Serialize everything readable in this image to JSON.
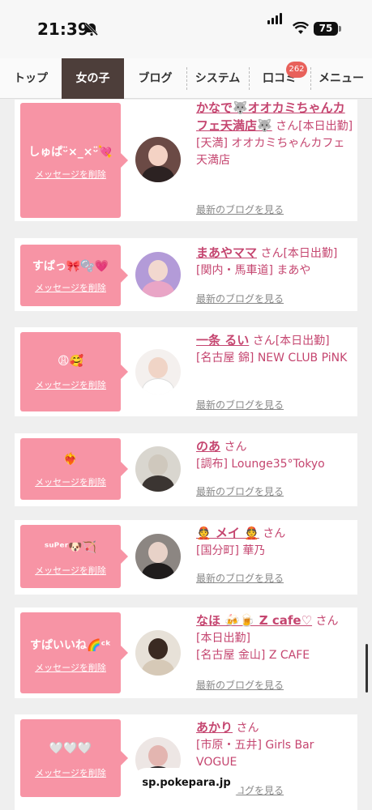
{
  "status": {
    "time": "21:39",
    "battery": "75"
  },
  "tabs": [
    {
      "label": "トップ"
    },
    {
      "label": "女の子"
    },
    {
      "label": "ブログ"
    },
    {
      "label": "システム"
    },
    {
      "label": "口コミ",
      "badge": "262"
    },
    {
      "label": "メニュー"
    }
  ],
  "common": {
    "delete_label": "メッセージを削除",
    "blog_label": "最新のブログを見る",
    "san": "さん"
  },
  "cards": [
    {
      "message": "しゅぱᵕ̈×_×ᵕ̈💘",
      "name": "かなで🐺オオカミちゃんカフェ天満店🐺",
      "status": "[本日出勤]",
      "location": "[天満] オオカミちゃんカフェ天満店"
    },
    {
      "message": "すぱっ🎀🫧💗",
      "name": "まあやママ",
      "status": "[本日出勤]",
      "location": "[関内・馬車道] まあや"
    },
    {
      "message": "😩🥰",
      "name": "一条 るい",
      "status": "[本日出勤]",
      "location": "[名古屋 錦] NEW CLUB PiNK"
    },
    {
      "message": "❤️‍🔥",
      "name": "のあ",
      "status": "",
      "location": "[調布] Lounge35°Tokyo"
    },
    {
      "message": "ˢᵘᴾᵉʳ🐶🏹",
      "name": "👲 メイ 👲",
      "status": "",
      "location": "[国分町] 華乃"
    },
    {
      "message": "すぱいいね🌈ᶜᵏ",
      "name": "なほ 🍻🍺 Z cafe♡",
      "status": "[本日出勤]",
      "location": "[名古屋 金山] Z CAFE"
    },
    {
      "message": "🤍🤍🤍",
      "name": "あかり",
      "status": "",
      "location": "[市原・五井] Girls Bar VOGUE"
    }
  ],
  "footer": {
    "url": "sp.pokepara.jp"
  }
}
